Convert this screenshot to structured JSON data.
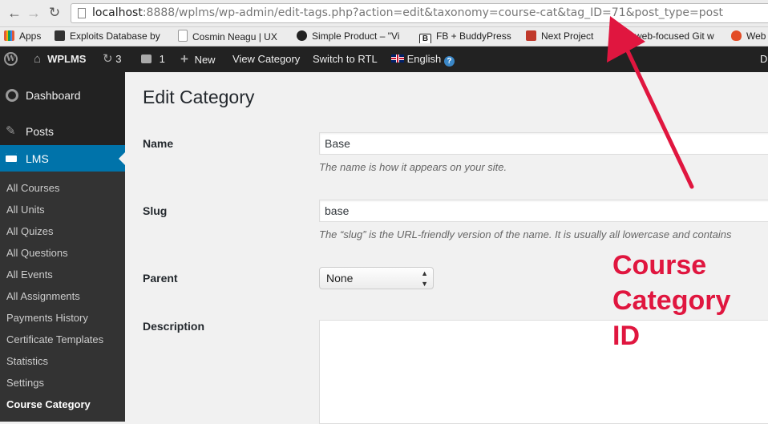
{
  "browser": {
    "url_host": "localhost",
    "url_rest": ":8888/wplms/wp-admin/edit-tags.php?action=edit&taxonomy=course-cat&tag_ID=71&post_type=post",
    "bookmarks": [
      {
        "label": "Apps",
        "icon": "apps-grid-icon",
        "color": "#e0593a"
      },
      {
        "label": "Exploits Database by",
        "icon": "exploit-db-icon",
        "color": "#333"
      },
      {
        "label": "Cosmin Neagu | UX",
        "icon": "page-icon",
        "color": "#ffffff"
      },
      {
        "label": "Simple Product – \"Vi",
        "icon": "github-icon",
        "color": "#222"
      },
      {
        "label": "FB + BuddyPress",
        "icon": "b-logo-icon",
        "color": "#222"
      },
      {
        "label": "Next Project",
        "icon": "flag-icon",
        "color": "#c0392b"
      },
      {
        "label": "web-focused Git w",
        "icon": "git-icon",
        "color": "#c0392b"
      },
      {
        "label": "Web",
        "icon": "flame-icon",
        "color": "#e34c26"
      }
    ]
  },
  "adminbar": {
    "site_name": "WPLMS",
    "updates_count": "3",
    "comments_count": "1",
    "new_label": "New",
    "view_category": "View Category",
    "switch_rtl": "Switch to RTL",
    "language": "English",
    "right_cut": "D"
  },
  "sidebar": {
    "dashboard": "Dashboard",
    "posts": "Posts",
    "lms": "LMS",
    "submenu": [
      "All Courses",
      "All Units",
      "All Quizes",
      "All Questions",
      "All Events",
      "All Assignments",
      "Payments History",
      "Certificate Templates",
      "Statistics",
      "Settings",
      "Course Category"
    ]
  },
  "main": {
    "title": "Edit Category",
    "name_label": "Name",
    "name_value": "Base",
    "name_desc": "The name is how it appears on your site.",
    "slug_label": "Slug",
    "slug_value": "base",
    "slug_desc": "The “slug” is the URL-friendly version of the name. It is usually all lowercase and contains",
    "parent_label": "Parent",
    "parent_value": "None",
    "description_label": "Description",
    "description_value": ""
  },
  "annotation": {
    "lines": [
      "Course",
      "Category",
      "ID"
    ],
    "color": "#e0163f"
  },
  "colors": {
    "admin_bar": "#222222",
    "sidebar": "#222222",
    "submenu": "#333333",
    "accent": "#0073aa"
  }
}
